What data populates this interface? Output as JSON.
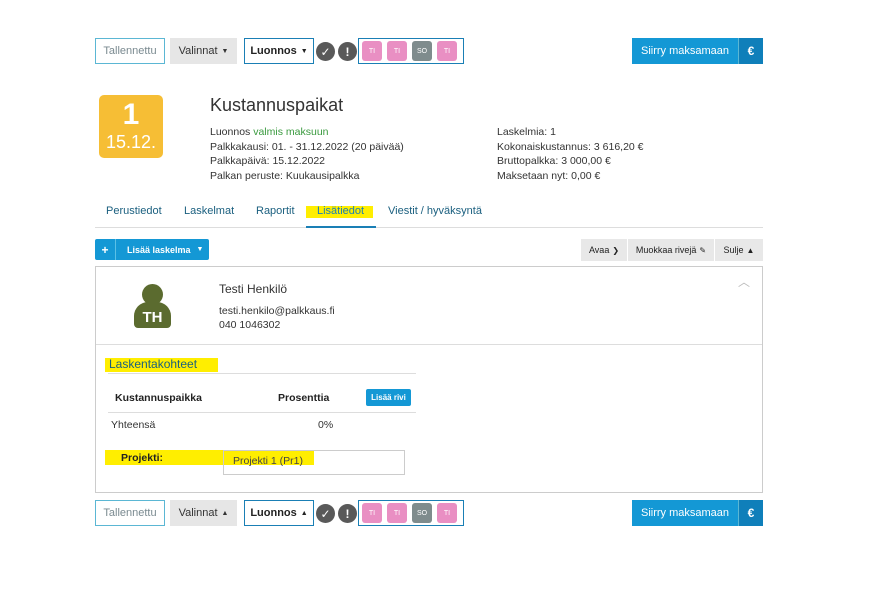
{
  "toolbar": {
    "saved_label": "Tallennettu",
    "options_label": "Valinnat",
    "status_label": "Luonnos",
    "check_icon": "check-circle-icon",
    "warning_icon": "exclamation-circle-icon",
    "badges": [
      {
        "label": "TI",
        "color": "#e98fc3"
      },
      {
        "label": "TI",
        "color": "#e98fc3"
      },
      {
        "label": "SO",
        "color": "#7f8c8d"
      },
      {
        "label": "TI",
        "color": "#e98fc3"
      }
    ],
    "pay_label": "Siirry maksamaan",
    "pay_icon": "€"
  },
  "header": {
    "day": "1",
    "date": "15.12.",
    "title": "Kustannuspaikat",
    "status_prefix": "Luonnos",
    "status_suffix": "valmis maksuun",
    "period": "Palkkakausi: 01. - 31.12.2022 (20 päivää)",
    "pay_date": "Palkkapäivä: 15.12.2022",
    "basis": "Palkan peruste: Kuukausipalkka",
    "calc_count": "Laskelmia: 1",
    "total_cost": "Kokonaiskustannus: 3 616,20 €",
    "gross": "Bruttopalkka: 3 000,00 €",
    "paid_now": "Maksetaan nyt: 0,00 €"
  },
  "tabs": [
    {
      "label": "Perustiedot"
    },
    {
      "label": "Laskelmat"
    },
    {
      "label": "Raportit"
    },
    {
      "label": "Lisätiedot"
    },
    {
      "label": "Viestit / hyväksyntä"
    }
  ],
  "actions": {
    "add_calc": "Lisää laskelma",
    "open": "Avaa",
    "edit_rows": "Muokkaa rivejä",
    "close": "Sulje"
  },
  "employee": {
    "initials": "TH",
    "name": "Testi Henkilö",
    "email": "testi.henkilo@palkkaus.fi",
    "phone": "040 1046302"
  },
  "allocation": {
    "section_title": "Laskentakohteet",
    "col_cost_center": "Kustannuspaikka",
    "col_percent": "Prosenttia",
    "add_row": "Lisää rivi",
    "total_label": "Yhteensä",
    "total_value": "0%",
    "project_label": "Projekti:",
    "project_value": "Projekti 1 (Pr1)"
  },
  "colors": {
    "accent": "#1498d5",
    "highlight": "#ffee00",
    "date_tile": "#f6be35",
    "avatar": "#5b6b2f"
  }
}
